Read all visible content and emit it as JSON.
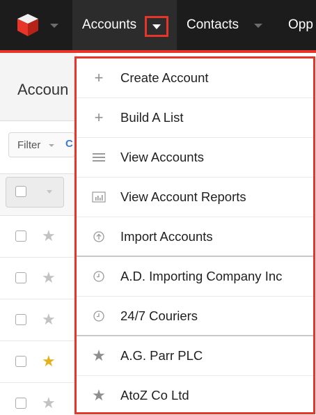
{
  "nav": {
    "items": [
      {
        "label": "Accounts"
      },
      {
        "label": "Contacts"
      },
      {
        "label": "Opp"
      }
    ]
  },
  "page": {
    "title": "Accoun",
    "filter_label": "Filter",
    "filter_extra": "C"
  },
  "list_rows": [
    {
      "favorite": false
    },
    {
      "favorite": false
    },
    {
      "favorite": false
    },
    {
      "favorite": true
    },
    {
      "favorite": false
    }
  ],
  "menu": {
    "items": [
      {
        "label": "Create Account",
        "icon": "plus-icon"
      },
      {
        "label": "Build A List",
        "icon": "plus-icon"
      },
      {
        "label": "View Accounts",
        "icon": "list-icon"
      },
      {
        "label": "View Account Reports",
        "icon": "bar-chart-icon"
      },
      {
        "label": "Import Accounts",
        "icon": "upload-icon"
      },
      {
        "label": "A.D. Importing Company Inc",
        "icon": "clock-icon"
      },
      {
        "label": "24/7 Couriers",
        "icon": "clock-icon"
      },
      {
        "label": "A.G. Parr PLC",
        "icon": "star-icon"
      },
      {
        "label": "AtoZ Co Ltd",
        "icon": "star-icon"
      }
    ]
  },
  "colors": {
    "accent": "#e8352a",
    "nav_bg": "#1c1c1c",
    "favorite_star": "#e3b21a"
  }
}
